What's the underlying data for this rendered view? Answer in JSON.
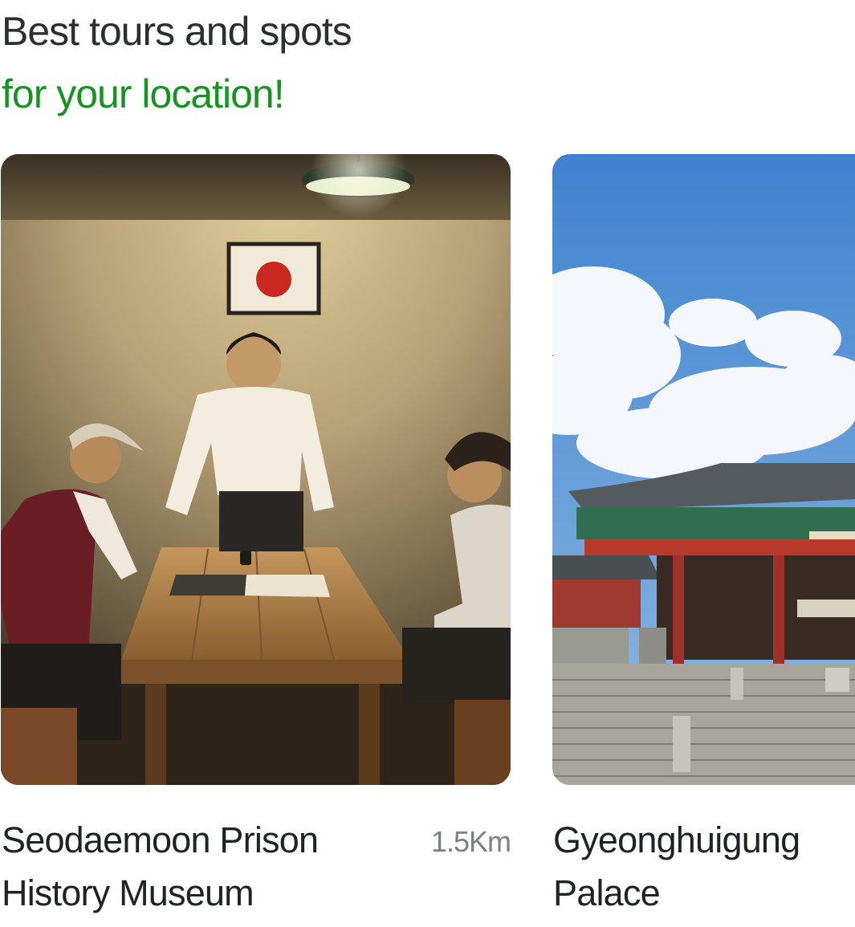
{
  "header": {
    "line1": "Best tours and spots",
    "line2": "for your location!"
  },
  "cards": [
    {
      "title": "Seodaemoon Prison\nHistory Museum",
      "distance": "1.5Km",
      "image": "museum-interrogation-room-photo"
    },
    {
      "title": "Gyeonghuigung\nPalace",
      "distance": "",
      "image": "palace-gate-photo"
    }
  ],
  "colors": {
    "heading_dark": "#2b2f33",
    "heading_accent": "#15951f",
    "distance_text": "#7a8088"
  }
}
